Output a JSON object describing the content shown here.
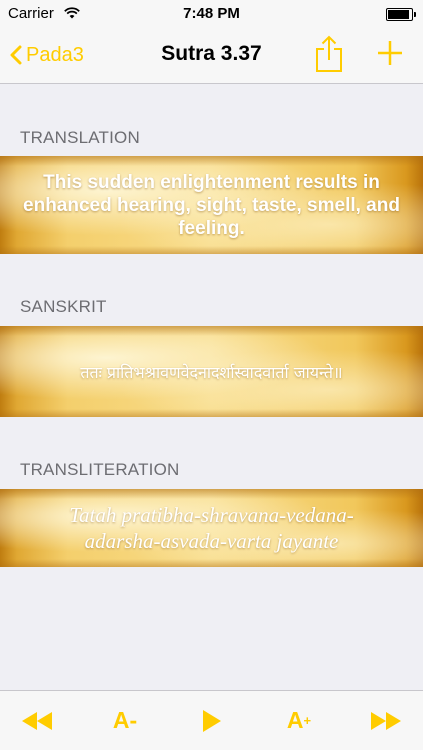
{
  "status_bar": {
    "carrier": "Carrier",
    "time": "7:48 PM",
    "battery_level": 0.9
  },
  "nav": {
    "back_label": "Pada3",
    "title": "Sutra 3.37",
    "share_icon": "share-icon",
    "add_icon": "plus-icon"
  },
  "sections": {
    "translation": {
      "header": "TRANSLATION",
      "text": "This sudden enlightenment results in enhanced hearing, sight, taste, smell, and feeling."
    },
    "sanskrit": {
      "header": "SANSKRIT",
      "text": "ततः प्रातिभश्रावणवेदनादर्शास्वादवार्ता जायन्ते॥"
    },
    "transliteration": {
      "header": "TRANSLITERATION",
      "text": "Tatah pratibha-shravana-vedana-adarsha-asvada-varta jayante"
    }
  },
  "toolbar": {
    "prev_icon": "rewind-icon",
    "decrease_label": "A-",
    "play_icon": "play-icon",
    "increase_label": "A",
    "increase_sup": "+",
    "next_icon": "fast-forward-icon"
  },
  "colors": {
    "accent": "#ffcc00",
    "background": "#efeff4",
    "header_text": "#6d6d72"
  }
}
